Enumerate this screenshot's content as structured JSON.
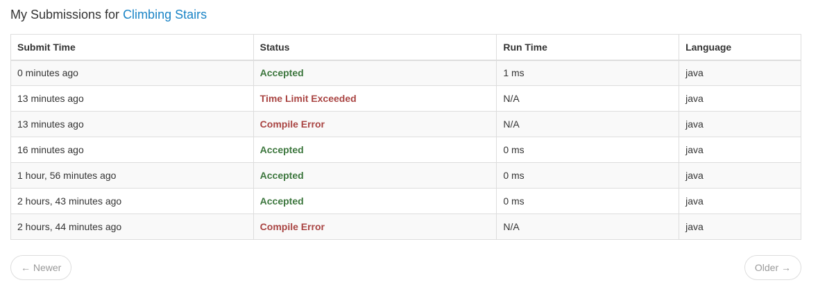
{
  "header": {
    "prefix": "My Submissions for",
    "problem_link": "Climbing Stairs"
  },
  "table": {
    "columns": [
      "Submit Time",
      "Status",
      "Run Time",
      "Language"
    ],
    "rows": [
      {
        "time": "0 minutes ago",
        "status": "Accepted",
        "status_kind": "accepted",
        "run_time": "1 ms",
        "language": "java"
      },
      {
        "time": "13 minutes ago",
        "status": "Time Limit Exceeded",
        "status_kind": "error",
        "run_time": "N/A",
        "language": "java"
      },
      {
        "time": "13 minutes ago",
        "status": "Compile Error",
        "status_kind": "error",
        "run_time": "N/A",
        "language": "java"
      },
      {
        "time": "16 minutes ago",
        "status": "Accepted",
        "status_kind": "accepted",
        "run_time": "0 ms",
        "language": "java"
      },
      {
        "time": "1 hour, 56 minutes ago",
        "status": "Accepted",
        "status_kind": "accepted",
        "run_time": "0 ms",
        "language": "java"
      },
      {
        "time": "2 hours, 43 minutes ago",
        "status": "Accepted",
        "status_kind": "accepted",
        "run_time": "0 ms",
        "language": "java"
      },
      {
        "time": "2 hours, 44 minutes ago",
        "status": "Compile Error",
        "status_kind": "error",
        "run_time": "N/A",
        "language": "java"
      }
    ]
  },
  "pager": {
    "newer_label": "← Newer",
    "older_label": "Older →"
  },
  "colors": {
    "link": "#1a84c6",
    "accepted": "#3c763d",
    "error": "#a94442"
  }
}
